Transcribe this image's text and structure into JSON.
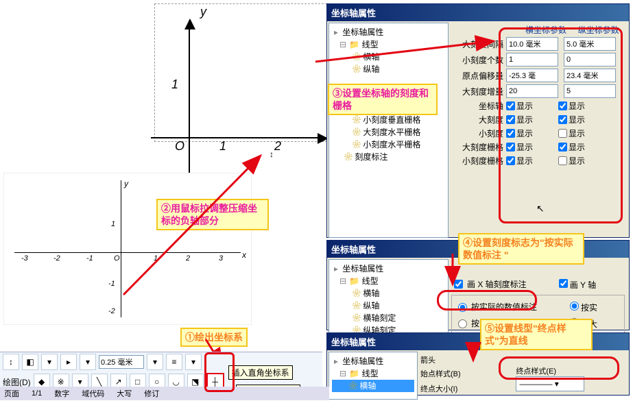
{
  "panelTitle": "坐标轴属性",
  "tree": {
    "root": "坐标轴属性",
    "folder": "线型",
    "items": [
      "横轴",
      "纵轴",
      "横轴刻定",
      "纵轴刻定",
      "小刻度垂直栅格",
      "大刻度水平栅格",
      "小刻度水平栅格",
      "刻度标注"
    ]
  },
  "headers": {
    "x": "横坐标参数",
    "y": "纵坐标参数"
  },
  "rows": {
    "r1": {
      "label": "大刻度间隔",
      "v1": "10.0 毫米",
      "v2": "5.0 毫米"
    },
    "r2": {
      "label": "小刻度个数",
      "v1": "1",
      "v2": "0"
    },
    "r3": {
      "label": "原点偏移量",
      "v1": "-25.3 毫",
      "v2": "23.4 毫米"
    },
    "r4": {
      "label": "大刻度增量",
      "v1": "20",
      "v2": "5"
    },
    "c1": {
      "label": "坐标轴"
    },
    "c2": {
      "label": "大刻度"
    },
    "c3": {
      "label": "小刻度"
    },
    "c4": {
      "label": "大刻度栅格"
    },
    "c5": {
      "label": "小刻度栅格"
    },
    "show": "显示"
  },
  "tree2": {
    "items": [
      "横轴",
      "纵轴",
      "横轴刻定",
      "纵轴刻定"
    ]
  },
  "panel2": {
    "cb1": "画 X 轴刻度标注",
    "cb2": "画 Y 轴",
    "radio1": "按实际的数值标注",
    "radio2": "按实",
    "radio3": "按大刻度数目标注",
    "radio4": "按大"
  },
  "panel3": {
    "l1": "箭头",
    "l2": "始点样式(B)",
    "l3": "终点大小(I)",
    "l4": "终点样式(E)"
  },
  "hints": {
    "h1": "①绘出坐标系",
    "h2": "②用鼠标拉调整压缩坐标的负轴部分",
    "h3": "③设置坐标轴的刻度和栅格",
    "h4": "④设置刻度标志为\"按实际数值标注 \"",
    "h5": "⑤设置线型\"终点样式\"为直线"
  },
  "toolbar": {
    "spin": "0.25 毫米",
    "menu": "绘图(D)",
    "tip1": "插入直角坐标系",
    "tip2": "插入直角坐标系",
    "tabs": [
      "页面",
      "1/1",
      "数字",
      "域代码",
      "大写",
      "修订"
    ]
  },
  "axis": {
    "y": "y",
    "x": "x",
    "O": "O",
    "ticks": [
      "1",
      "2",
      "-1",
      "-2"
    ],
    "small": {
      "y": "y",
      "x": "x",
      "O": "O",
      "xt": [
        "-3",
        "-2",
        "-1",
        "1",
        "2",
        "3"
      ],
      "yt": [
        "1",
        "-1",
        "-2"
      ]
    }
  }
}
